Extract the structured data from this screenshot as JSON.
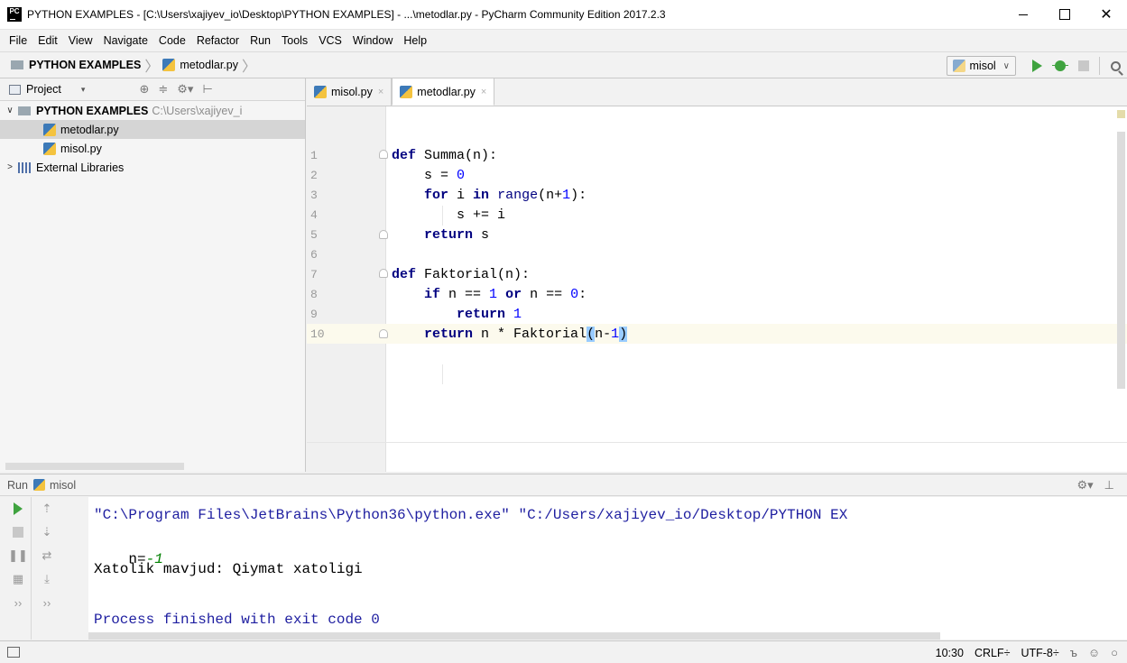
{
  "window": {
    "app_icon_text": "PC",
    "title": "PYTHON EXAMPLES - [C:\\Users\\xajiyev_io\\Desktop\\PYTHON EXAMPLES] - ...\\metodlar.py - PyCharm Community Edition 2017.2.3",
    "minimize_glyph": "",
    "maximize_glyph": "",
    "close_glyph": "✕"
  },
  "menu": {
    "items": [
      "File",
      "Edit",
      "View",
      "Navigate",
      "Code",
      "Refactor",
      "Run",
      "Tools",
      "VCS",
      "Window",
      "Help"
    ]
  },
  "navbar": {
    "project": "PYTHON EXAMPLES",
    "file": "metodlar.py",
    "separator": "〉",
    "run_config": "misol",
    "run_config_chevron": "∨",
    "icons": [
      "run-icon",
      "debug-icon",
      "stop-icon",
      "search-icon"
    ]
  },
  "project_panel": {
    "title": "Project",
    "chevron": "▾",
    "header_icons": [
      "⊕",
      "≑",
      "⚙▾",
      "⊢"
    ],
    "tree": {
      "root": {
        "arrow": "∨",
        "name": "PYTHON EXAMPLES",
        "path": "C:\\Users\\xajiyev_i"
      },
      "files": [
        "metodlar.py",
        "misol.py"
      ],
      "libs": {
        "arrow": ">",
        "name": "External Libraries"
      }
    }
  },
  "editor": {
    "tabs": [
      {
        "label": "misol.py",
        "close": "×"
      },
      {
        "label": "metodlar.py",
        "close": "×"
      }
    ],
    "line_numbers": [
      "1",
      "2",
      "3",
      "4",
      "5",
      "6",
      "7",
      "8",
      "9",
      "10"
    ],
    "lines": [
      "def Summa(n):",
      "    s = 0",
      "    for i in range(n+1):",
      "        s += i",
      "    return s",
      "",
      "def Faktorial(n):",
      "    if n == 1 or n == 0:",
      "        return 1",
      "    return n * Faktorial(n-1)"
    ],
    "current_line": 10
  },
  "run_panel": {
    "label": "Run",
    "config": "misol",
    "header_icons": [
      "⚙▾",
      "⊥"
    ],
    "toolbar_col1": [
      "run-again-icon",
      "stop-icon",
      "pause-icon",
      "layout-icon",
      "more-icon"
    ],
    "toolbar_col2": [
      "up-icon",
      "down-icon",
      "soft-wrap-icon",
      "scroll-end-icon",
      "more-icon"
    ],
    "console": {
      "command": "\"C:\\Program Files\\JetBrains\\Python36\\python.exe\" \"C:/Users/xajiyev_io/Desktop/PYTHON EX",
      "prompt": "n=",
      "input": "-1",
      "error": "Xatolik mavjud: Qiymat xatoligi",
      "exit": "Process finished with exit code 0"
    }
  },
  "status_bar": {
    "position": "10:30",
    "line_sep": "CRLF÷",
    "encoding": "UTF-8÷",
    "icons": [
      "lock-icon",
      "inspector-icon",
      "event-log-icon"
    ]
  }
}
